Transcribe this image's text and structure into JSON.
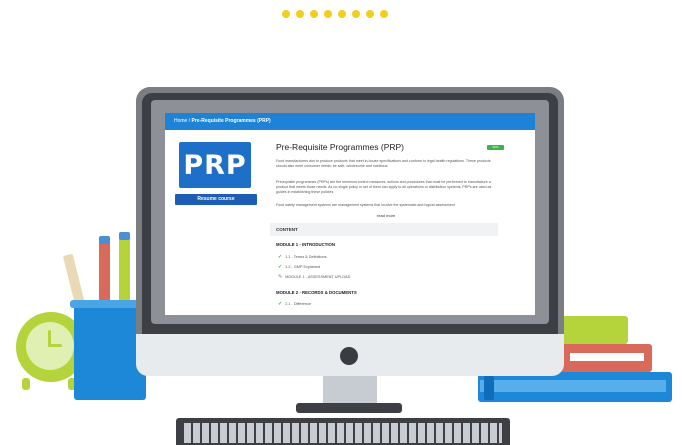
{
  "breadcrumb": {
    "home": "Home",
    "separator": " / ",
    "current": "Pre-Requisite Programmes (PRP)"
  },
  "course": {
    "thumbnail_text": "PRP",
    "resume_label": "Resume course",
    "title": "Pre-Requisite Programmes (PRP)",
    "badge": "99%",
    "paragraphs": [
      "Food manufacturers aim to produce products that meet in-house specifications and conform to legal health regulations. These products should also meet consumer needs: be safe, wholesome and nutritious.",
      "Prerequisite programmes (PRPs) are the minimum control measures, actions and procedures that must be performed to manufacture a product that meets those needs. As no single policy or set of them can apply to all operations or distribution systems, PRPs are used as guides in establishing these policies.",
      "Food safety management systems are management systems that involve the systematic and logical assessment"
    ],
    "read_more": "read more"
  },
  "content": {
    "header": "CONTENT",
    "modules": [
      {
        "title": "MODULE 1 - INTRODUCTION",
        "lessons": [
          {
            "label": "1.1 - Terms & Definitions",
            "status": "check"
          },
          {
            "label": "1.2 - GMP Explained",
            "status": "check"
          },
          {
            "label": "MODULE 1 - ASSESSMENT UPLOAD",
            "status": "pencil"
          }
        ]
      },
      {
        "title": "MODULE 2 - RECORDS & DOCUMENTS",
        "lessons": [
          {
            "label": "2.1 - Difference",
            "status": "check"
          }
        ]
      }
    ]
  },
  "colors": {
    "accent": "#1e83d6",
    "button": "#1d5db3",
    "success": "#39b54a",
    "dots": "#f2cf1f",
    "green": "#b5d33b",
    "coral": "#d9695a"
  },
  "icons": [
    "check-icon",
    "pencil-icon",
    "power-button-icon",
    "clock-icon"
  ]
}
